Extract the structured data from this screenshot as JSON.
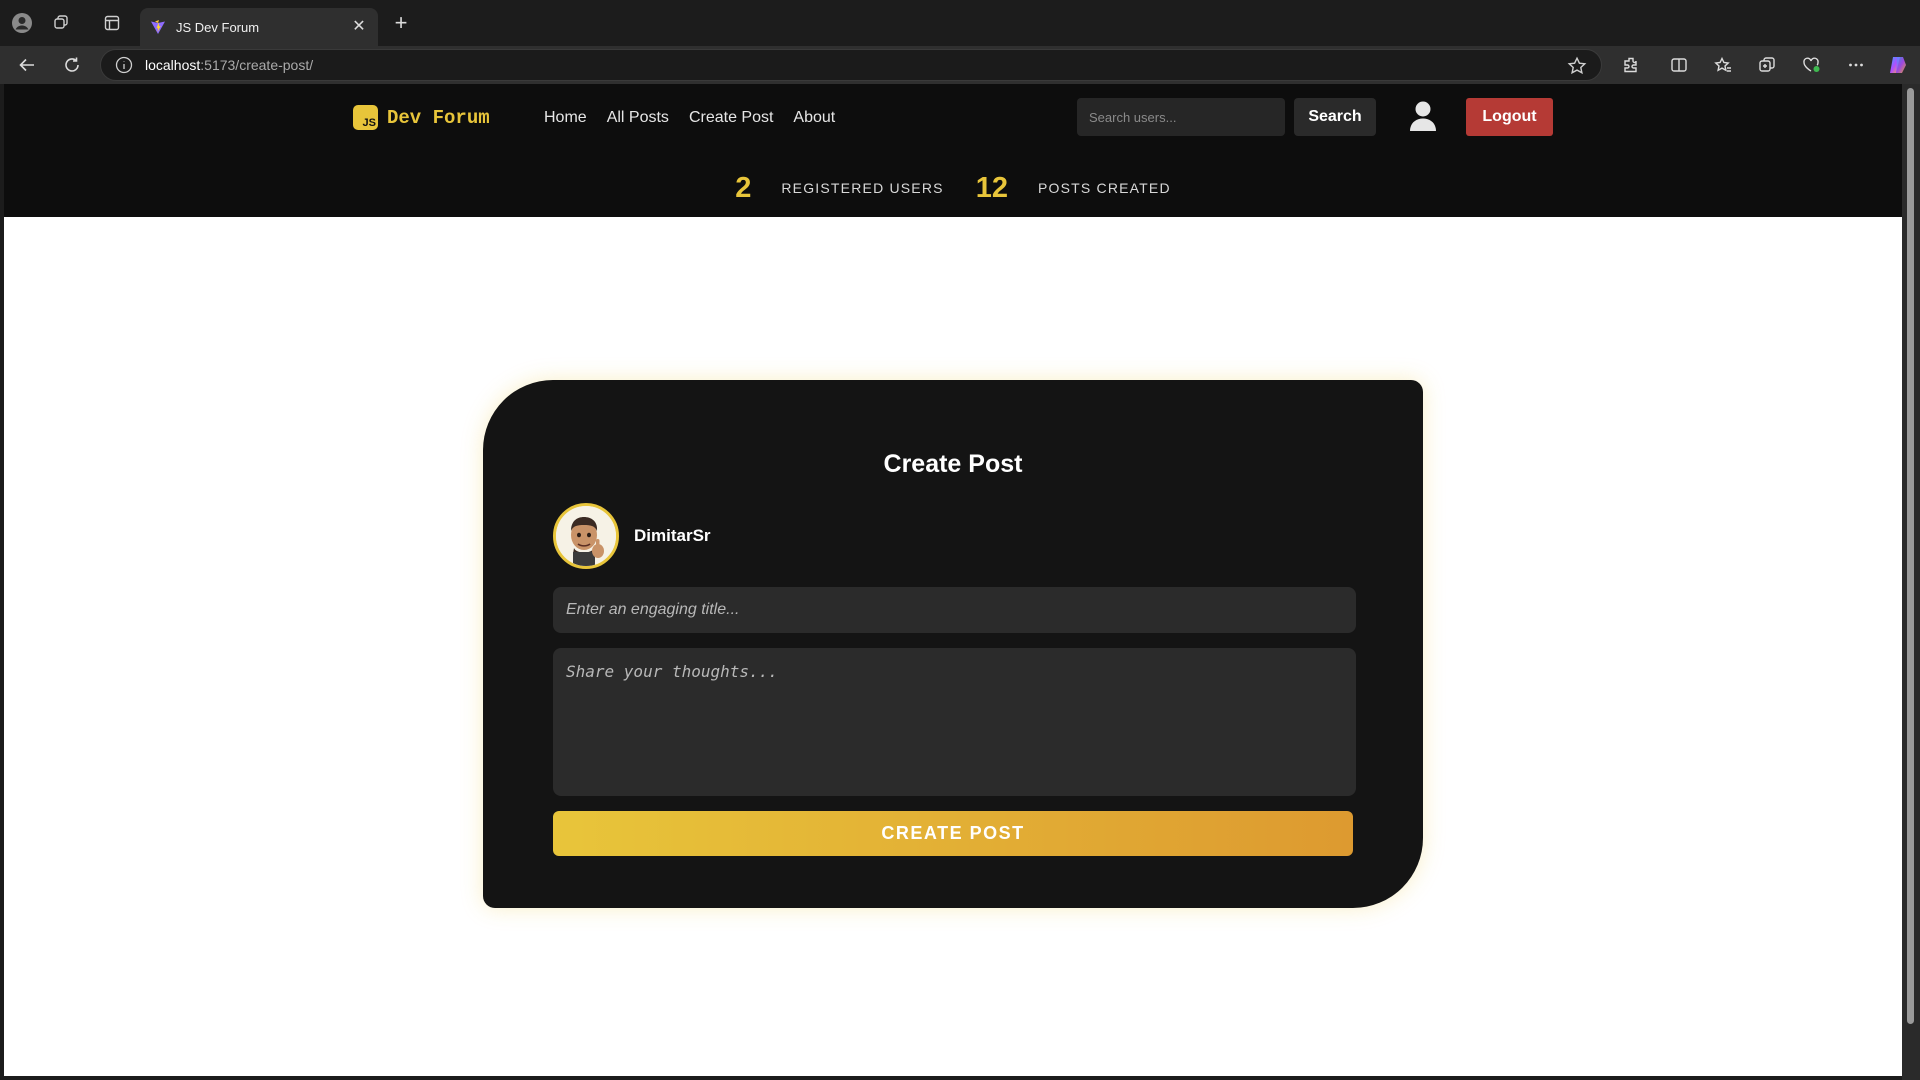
{
  "browser": {
    "tab_title": "JS Dev Forum",
    "url_host": "localhost",
    "url_path": ":5173/create-post/"
  },
  "header": {
    "logo_badge": "JS",
    "logo_text": "Dev Forum",
    "nav": [
      "Home",
      "All Posts",
      "Create Post",
      "About"
    ],
    "search_placeholder": "Search users...",
    "search_label": "Search",
    "logout_label": "Logout"
  },
  "stats": {
    "users_count": "2",
    "users_label": "REGISTERED USERS",
    "posts_count": "12",
    "posts_label": "POSTS CREATED"
  },
  "form": {
    "heading": "Create Post",
    "username": "DimitarSr",
    "title_placeholder": "Enter an engaging title...",
    "body_placeholder": "Share your thoughts...",
    "submit_label": "CREATE POST"
  },
  "colors": {
    "accent": "#e8c53a",
    "accent_dark": "#dd9a30",
    "danger": "#b53a35",
    "header_bg": "#0d0d0d",
    "card_bg": "#141414"
  }
}
